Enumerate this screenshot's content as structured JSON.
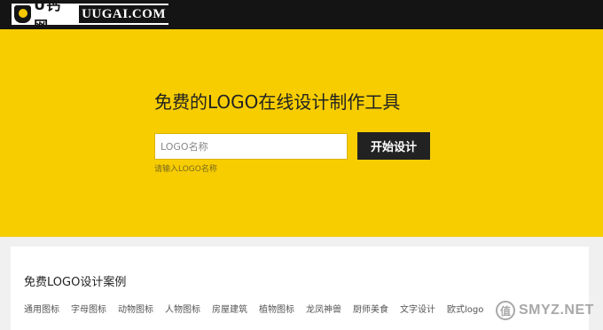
{
  "header": {
    "logo_cn": "U钙网",
    "logo_en": "UUGAI.COM"
  },
  "hero": {
    "title": "免费的LOGO在线设计制作工具",
    "input_placeholder": "LOGO名称",
    "input_value": "",
    "start_button": "开始设计",
    "hint": "请输入LOGO名称"
  },
  "cases": {
    "title": "免费LOGO设计案例",
    "categories": [
      "通用图标",
      "字母图标",
      "动物图标",
      "人物图标",
      "房屋建筑",
      "植物图标",
      "龙凤神兽",
      "厨师美食",
      "文字设计",
      "欧式logo"
    ]
  },
  "watermark": {
    "icon_text": "值",
    "text": "SMYZ.NET"
  },
  "colors": {
    "header_bg": "#141414",
    "hero_bg": "#f7cd00",
    "button_bg": "#222222",
    "page_bg": "#f0f0f0"
  },
  "icons": [
    "uugai-logo-icon",
    "watermark-icon"
  ]
}
